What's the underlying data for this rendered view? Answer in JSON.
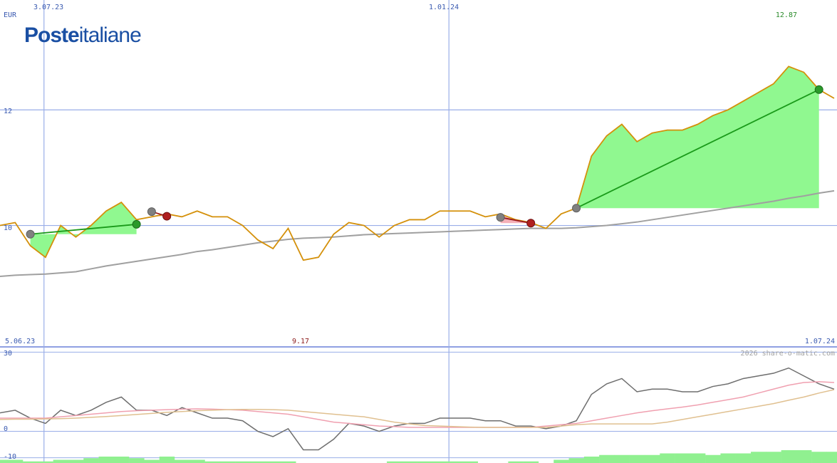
{
  "logo": {
    "part1": "Poste",
    "part2": "italiane",
    "color": "#1a4fa3"
  },
  "chart_data": {
    "type": "line",
    "currency_label": "EUR",
    "x_tick_labels": [
      "3.07.23",
      "1.01.24"
    ],
    "date_start": "5.06.23",
    "date_end": "1.07.24",
    "y_ticks": [
      10,
      12
    ],
    "ylim": [
      7.9,
      13.9
    ],
    "max_label": "12.87",
    "min_label": "9.17",
    "watermark": "2026 share-o-matic.com",
    "price": {
      "color": "#d4900a",
      "values": [
        10.0,
        10.05,
        9.65,
        9.45,
        10.0,
        9.8,
        10.0,
        10.25,
        10.4,
        10.1,
        10.15,
        10.2,
        10.15,
        10.25,
        10.15,
        10.15,
        10.0,
        9.75,
        9.6,
        9.95,
        9.4,
        9.45,
        9.85,
        10.05,
        10.0,
        9.8,
        10.0,
        10.1,
        10.1,
        10.25,
        10.25,
        10.25,
        10.15,
        10.2,
        10.1,
        10.05,
        9.95,
        10.2,
        10.3,
        11.2,
        11.55,
        11.75,
        11.45,
        11.6,
        11.65,
        11.65,
        11.75,
        11.9,
        12.0,
        12.15,
        12.3,
        12.45,
        12.75,
        12.65,
        12.35,
        12.2
      ],
      "moving_average_color": "#a0a0a0",
      "moving_average": [
        9.12,
        9.14,
        9.15,
        9.16,
        9.18,
        9.2,
        9.25,
        9.3,
        9.34,
        9.38,
        9.42,
        9.46,
        9.5,
        9.55,
        9.58,
        9.62,
        9.66,
        9.7,
        9.73,
        9.76,
        9.78,
        9.79,
        9.8,
        9.82,
        9.84,
        9.85,
        9.86,
        9.87,
        9.88,
        9.89,
        9.9,
        9.91,
        9.92,
        9.93,
        9.94,
        9.95,
        9.95,
        9.95,
        9.96,
        9.98,
        10.0,
        10.03,
        10.06,
        10.1,
        10.14,
        10.18,
        10.22,
        10.26,
        10.3,
        10.34,
        10.38,
        10.42,
        10.47,
        10.51,
        10.56,
        10.6
      ],
      "trades": [
        {
          "entry_index": 2,
          "entry": 9.85,
          "exit_index": 9,
          "exit": 10.02,
          "result": "gain"
        },
        {
          "entry_index": 10,
          "entry": 10.24,
          "exit_index": 11,
          "exit": 10.16,
          "result": "loss"
        },
        {
          "entry_index": 33,
          "entry": 10.14,
          "exit_index": 35,
          "exit": 10.04,
          "result": "loss"
        },
        {
          "entry_index": 38,
          "entry": 10.3,
          "exit_index": 54,
          "exit": 12.35,
          "result": "gain"
        }
      ]
    },
    "oscillator": {
      "y_ticks": [
        30,
        0,
        -10
      ],
      "ylim": [
        -12,
        32
      ],
      "series": [
        {
          "color": "#6e6e6e",
          "values": [
            7,
            8,
            5,
            3,
            8,
            6,
            8,
            11,
            13,
            8,
            8,
            6,
            9,
            7,
            5,
            5,
            4,
            0,
            -2,
            1,
            -7,
            -7,
            -3,
            3,
            2,
            0,
            2,
            3,
            3,
            5,
            5,
            5,
            4,
            4,
            2,
            2,
            1,
            2,
            4,
            14,
            18,
            20,
            15,
            16,
            16,
            15,
            15,
            17,
            18,
            20,
            21,
            22,
            24,
            21,
            18,
            16
          ]
        },
        {
          "color": "#f0a0b0",
          "values": [
            5,
            5,
            5,
            5,
            5.5,
            6,
            6.5,
            7,
            7.5,
            7.8,
            8,
            8.2,
            8.4,
            8.5,
            8.4,
            8.2,
            8,
            7.5,
            7,
            6.5,
            5.5,
            4.5,
            3.5,
            3,
            2.5,
            2,
            1.8,
            1.5,
            1.5,
            1.5,
            1.5,
            1.5,
            1.5,
            1.5,
            1.5,
            1.5,
            2,
            2.5,
            3,
            4,
            5,
            6,
            7,
            7.8,
            8.5,
            9.2,
            10,
            11,
            12,
            13,
            14.5,
            16,
            17.5,
            18.5,
            18.8,
            18.5
          ]
        },
        {
          "color": "#e0c090",
          "values": [
            4.5,
            4.6,
            4.6,
            4.7,
            4.8,
            5,
            5.3,
            5.6,
            6,
            6.4,
            6.8,
            7.2,
            7.5,
            7.8,
            8,
            8.2,
            8.3,
            8.3,
            8.2,
            8,
            7.5,
            7,
            6.5,
            6,
            5.5,
            4.5,
            3.5,
            2.8,
            2.2,
            2,
            1.8,
            1.6,
            1.5,
            1.5,
            1.5,
            1.5,
            1.5,
            2,
            2.5,
            2.8,
            2.8,
            2.8,
            2.8,
            2.8,
            3.5,
            4.5,
            5.5,
            6.5,
            7.5,
            8.5,
            9.5,
            10.5,
            11.8,
            13,
            14.5,
            15.8
          ]
        }
      ]
    },
    "volume": {
      "color": "#90f090",
      "values": [
        2,
        2,
        1,
        1,
        2,
        2,
        3,
        4,
        4,
        3,
        2,
        4,
        2,
        2,
        1,
        1,
        1,
        1,
        1,
        1,
        0,
        0,
        0,
        0,
        0,
        0,
        1,
        1,
        1,
        1,
        1,
        1,
        0,
        0,
        1,
        1,
        0,
        2,
        3,
        4,
        5,
        5,
        5,
        5,
        6,
        6,
        6,
        5,
        6,
        6,
        7,
        7,
        8,
        8,
        7,
        7
      ]
    }
  }
}
